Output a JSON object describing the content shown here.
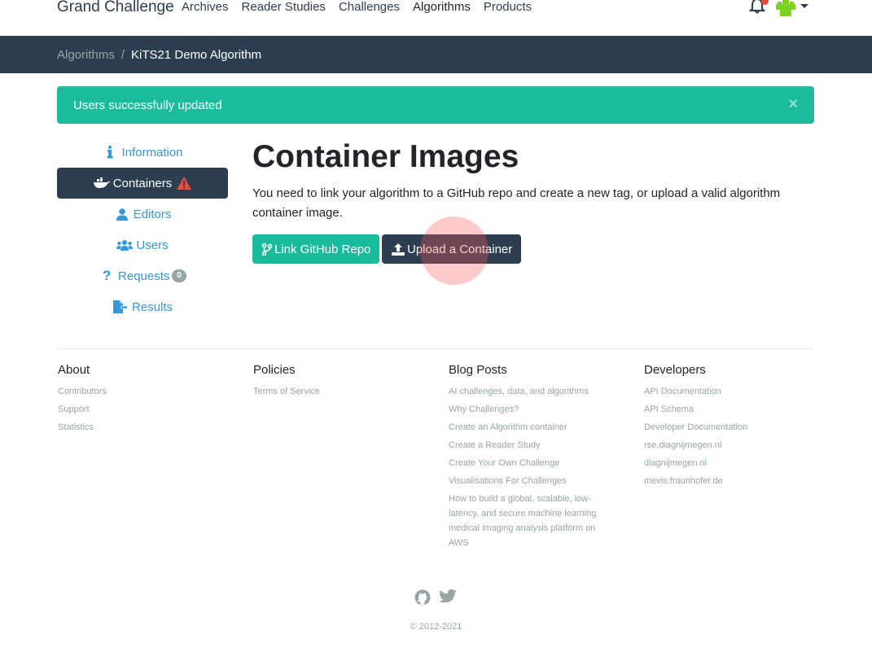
{
  "nav": {
    "brand": "Grand Challenge",
    "links": [
      "Archives",
      "Reader Studies",
      "Challenges",
      "Algorithms",
      "Products"
    ],
    "active": "Algorithms",
    "notification_icon": "bell-icon",
    "avatar_icon": "user-avatar"
  },
  "breadcrumb": {
    "parent": "Algorithms",
    "separator": "/",
    "current": "KiTS21 Demo Algorithm"
  },
  "alert": {
    "message": "Users successfully updated",
    "close": "×",
    "color": "#1abc9c"
  },
  "sidebar": {
    "items": [
      {
        "label": "Information",
        "icon": "info-icon"
      },
      {
        "label": "Containers",
        "icon": "docker-icon",
        "warning": "warning-icon"
      },
      {
        "label": "Editors",
        "icon": "user-icon"
      },
      {
        "label": "Users",
        "icon": "users-icon"
      },
      {
        "label": "Requests",
        "icon": "question-icon",
        "badge": "0"
      },
      {
        "label": "Results",
        "icon": "file-export-icon"
      }
    ]
  },
  "main": {
    "title": "Container Images",
    "description": "You need to link your algorithm to a GitHub repo and create a new tag, or upload a valid algorithm container image.",
    "link_button": "Link GitHub Repo",
    "upload_button": "Upload a Container"
  },
  "footer": {
    "columns": [
      {
        "title": "About",
        "links": [
          "Contributors",
          "Support",
          "Statistics"
        ]
      },
      {
        "title": "Policies",
        "links": [
          "Terms of Service"
        ]
      },
      {
        "title": "Blog Posts",
        "links": [
          "AI challenges, data, and algorithms",
          "Why Challenges?",
          "Create an Algorithm container",
          "Create a Reader Study",
          "Create Your Own Challenge",
          "Visualisations For Challenges",
          "How to build a global, scalable, low-latency, and secure machine learning medical imaging analysis platform on AWS"
        ]
      },
      {
        "title": "Developers",
        "links": [
          "API Documentation",
          "API Schema",
          "Developer Documentation",
          "rse.diagnijmegen.nl",
          "diagnijmegen.nl",
          "mevis.fraunhofer.de"
        ]
      }
    ],
    "copyright": "© 2012-2021"
  },
  "colors": {
    "primary": "#2c3e50",
    "success": "#18bc9c",
    "link": "#3498db",
    "muted": "#95a5a6",
    "danger": "#e74c3c"
  }
}
